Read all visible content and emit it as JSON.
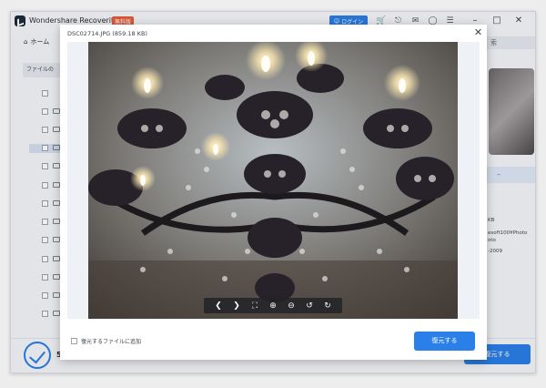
{
  "app": {
    "title": "Wondershare Recoverit",
    "edition": "無料版",
    "login_label": "ログイン",
    "home_tab": "ホーム"
  },
  "background": {
    "file_path_button": "ファイルの",
    "search_placeholder": "索",
    "info_size": "KB",
    "info_path_1": "esoft100¥Photo",
    "info_path_2": "oto",
    "info_date": "-2009",
    "bottom_letter": "5",
    "restore_label": "復元する"
  },
  "modal": {
    "title": "DSC02714.JPG (859.18 KB)",
    "add_to_recover_label": "復元するファイルに追加",
    "restore_label": "復元する"
  },
  "icons": {
    "toolbar": [
      "cart-icon",
      "headset-icon",
      "mail-icon",
      "help-icon",
      "menu-icon"
    ],
    "viewer": [
      "prev-icon",
      "next-icon",
      "fullscreen-icon",
      "zoom-in-icon",
      "zoom-out-icon",
      "rotate-left-icon",
      "rotate-right-icon"
    ]
  },
  "colors": {
    "accent": "#2b7fe8",
    "badge": "#e85c3a"
  }
}
